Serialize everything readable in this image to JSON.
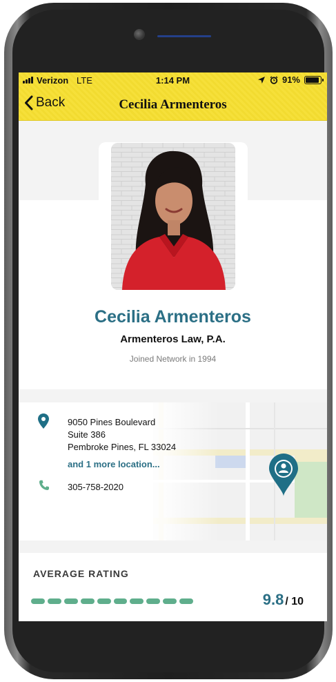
{
  "status_bar": {
    "carrier": "Verizon",
    "network": "LTE",
    "time": "1:14 PM",
    "battery": "91%",
    "battery_level": 0.91
  },
  "nav": {
    "back_label": "Back",
    "title": "Cecilia Armenteros"
  },
  "profile": {
    "name": "Cecilia Armenteros",
    "firm": "Armenteros Law, P.A.",
    "joined": "Joined Network in 1994"
  },
  "location": {
    "address_line1": "9050 Pines Boulevard",
    "address_line2": "Suite 386",
    "address_line3": "Pembroke Pines, FL 33024",
    "more_locations": "and 1 more location...",
    "phone": "305-758-2020"
  },
  "rating": {
    "label": "AVERAGE RATING",
    "score": "9.8",
    "max": "/ 10",
    "fraction": 0.98
  },
  "colors": {
    "header": "#f6e03a",
    "brand": "#2b6f85",
    "rating_bar": "#5fae8c",
    "icon": "#1f6f86"
  },
  "icons": [
    "chevron-left-icon",
    "location-arrow-icon",
    "alarm-icon",
    "map-pin-icon",
    "phone-icon",
    "user-location-pin-icon"
  ]
}
